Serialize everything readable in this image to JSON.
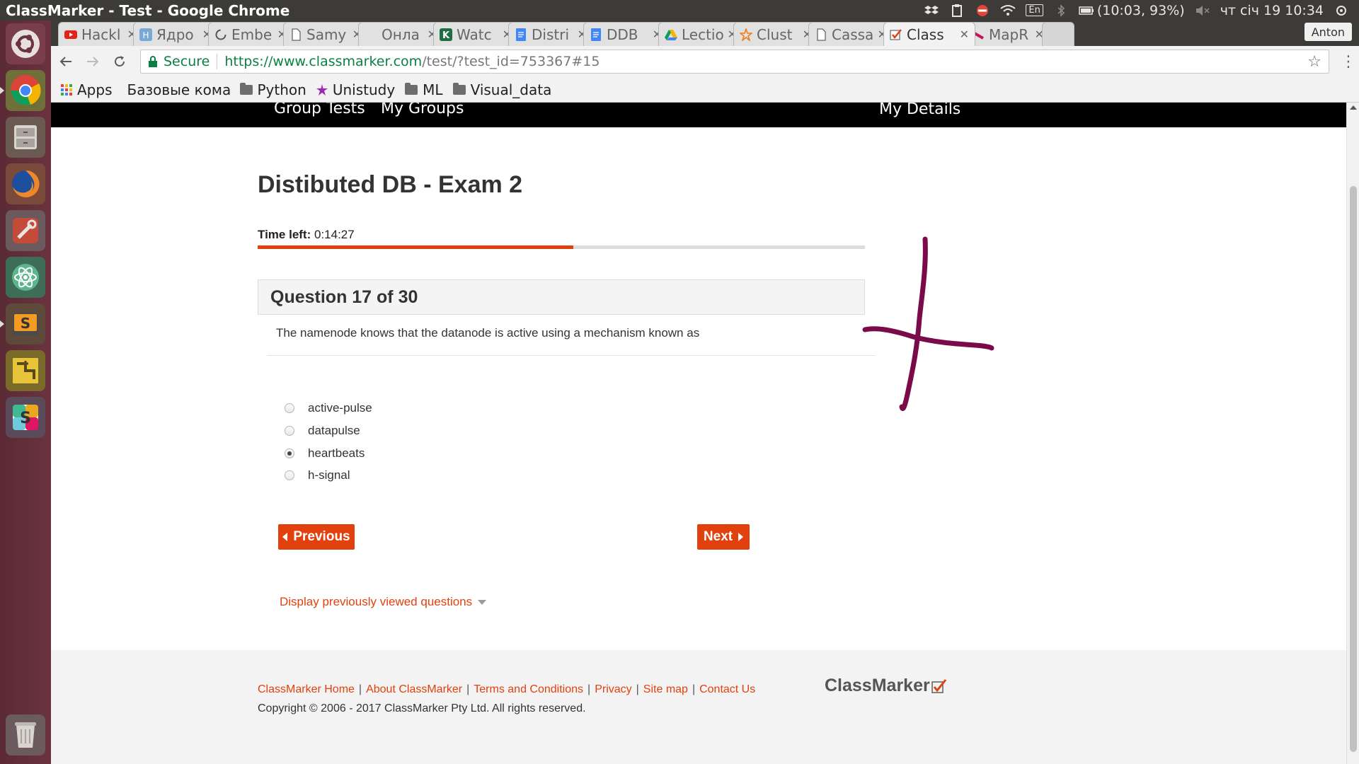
{
  "os_panel": {
    "window_title": "ClassMarker - Test - Google Chrome",
    "lang": "En",
    "battery": "(10:03, 93%)",
    "clock": "чт січ 19 10:34"
  },
  "browser": {
    "tabs": [
      {
        "label": "Hackl",
        "icon": "youtube-icon"
      },
      {
        "label": "Ядро",
        "icon": "h-icon"
      },
      {
        "label": "Embe",
        "icon": "loading-icon"
      },
      {
        "label": "Samy",
        "icon": "page-icon"
      },
      {
        "label": "Онла",
        "icon": "blank-icon"
      },
      {
        "label": "Watc",
        "icon": "k-icon"
      },
      {
        "label": "Distri",
        "icon": "docs-icon"
      },
      {
        "label": "DDB",
        "icon": "docs-icon"
      },
      {
        "label": "Lectio",
        "icon": "drive-icon"
      },
      {
        "label": "Clust",
        "icon": "star-icon"
      },
      {
        "label": "Cassa",
        "icon": "page-icon"
      },
      {
        "label": "Class",
        "icon": "classmarker-icon"
      },
      {
        "label": "MapR",
        "icon": "mapr-icon"
      }
    ],
    "profile": "Anton",
    "secure_label": "Secure",
    "url_scheme_host": "https://www.classmarker.com",
    "url_path": "/test/?test_id=753367#15",
    "bookmarks": [
      {
        "label": "Apps"
      },
      {
        "label": "Базовые коман"
      },
      {
        "label": "Python"
      },
      {
        "label": "Unistudy"
      },
      {
        "label": "ML"
      },
      {
        "label": "Visual_data"
      }
    ]
  },
  "site_nav": {
    "group_tests": "Group Tests",
    "my_groups": "My Groups",
    "my_details": "My Details"
  },
  "exam": {
    "title": "Distibuted DB - Exam 2",
    "time_left_label": "Time left:",
    "time_left_value": "0:14:27",
    "time_progress_fraction": 0.52,
    "question_header": "Question 17 of 30",
    "question_text": "The namenode knows that the datanode is active using a mechanism known as",
    "options": [
      {
        "label": "active-pulse",
        "selected": false
      },
      {
        "label": "datapulse",
        "selected": false
      },
      {
        "label": "heartbeats",
        "selected": true
      },
      {
        "label": "h-signal",
        "selected": false
      }
    ],
    "previous_label": "Previous",
    "next_label": "Next",
    "display_previous_label": "Display previously viewed questions"
  },
  "footer": {
    "links": [
      "ClassMarker Home",
      "About ClassMarker",
      "Terms and Conditions",
      "Privacy",
      "Site map",
      "Contact Us"
    ],
    "copyright": "Copyright © 2006 - 2017 ClassMarker Pty Ltd. All rights reserved.",
    "logo_text": "ClassMarker"
  },
  "colors": {
    "accent": "#e2410e",
    "annotation": "#7a0a4a"
  }
}
